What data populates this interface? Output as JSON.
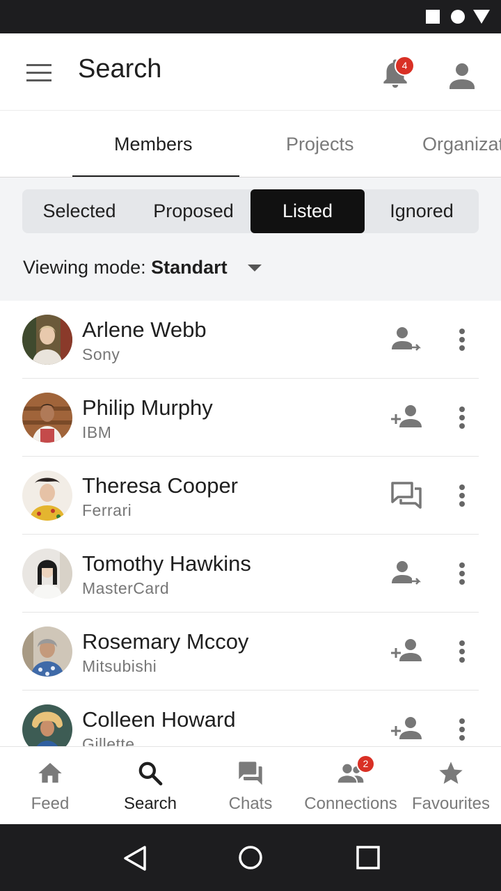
{
  "app": {
    "title": "Search",
    "notifications_count": "4",
    "accent_color": "#d93025"
  },
  "tabs": [
    {
      "label": "Members",
      "active": true
    },
    {
      "label": "Projects",
      "active": false
    },
    {
      "label": "Organizations",
      "active": false
    }
  ],
  "segments": [
    {
      "label": "Selected",
      "active": false
    },
    {
      "label": "Proposed",
      "active": false
    },
    {
      "label": "Listed",
      "active": true
    },
    {
      "label": "Ignored",
      "active": false
    }
  ],
  "viewing_mode": {
    "label": "Viewing mode:",
    "value": "Standart"
  },
  "members": [
    {
      "name": "Arlene Webb",
      "company": "Sony",
      "action_icon": "person-arrow-icon"
    },
    {
      "name": "Philip Murphy",
      "company": "IBM",
      "action_icon": "person-add-icon"
    },
    {
      "name": "Theresa Cooper",
      "company": "Ferrari",
      "action_icon": "chat-icon"
    },
    {
      "name": "Tomothy Hawkins",
      "company": "MasterCard",
      "action_icon": "person-arrow-icon"
    },
    {
      "name": "Rosemary Mccoy",
      "company": "Mitsubishi",
      "action_icon": "person-add-icon"
    },
    {
      "name": "Colleen Howard",
      "company": "Gillette",
      "action_icon": "person-add-icon"
    }
  ],
  "bottom_nav": [
    {
      "label": "Feed",
      "icon": "home-icon",
      "active": false
    },
    {
      "label": "Search",
      "icon": "search-icon",
      "active": true
    },
    {
      "label": "Chats",
      "icon": "chats-icon",
      "active": false
    },
    {
      "label": "Connections",
      "icon": "connections-icon",
      "active": false,
      "badge": "2"
    },
    {
      "label": "Favourites",
      "icon": "star-icon",
      "active": false
    }
  ]
}
